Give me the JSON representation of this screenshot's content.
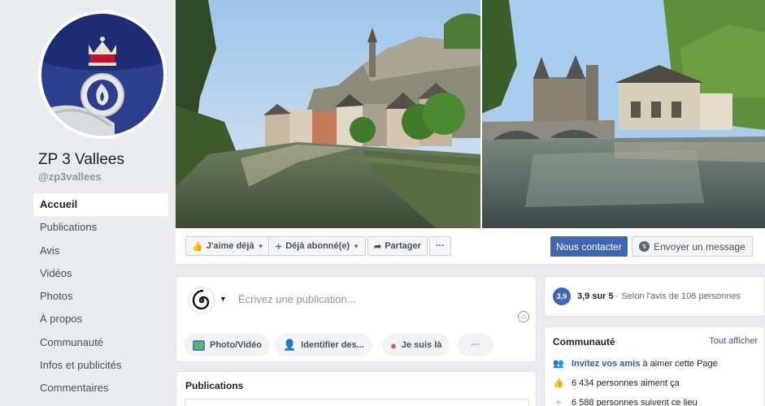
{
  "page": {
    "name": "ZP 3 Vallees",
    "handle": "@zp3vallees"
  },
  "nav": {
    "items": [
      {
        "label": "Accueil",
        "active": true
      },
      {
        "label": "Publications"
      },
      {
        "label": "Avis"
      },
      {
        "label": "Vidéos"
      },
      {
        "label": "Photos"
      },
      {
        "label": "À propos"
      },
      {
        "label": "Communauté"
      },
      {
        "label": "Infos et publicités"
      },
      {
        "label": "Commentaires"
      }
    ]
  },
  "actions": {
    "like_label": "J'aime déjà",
    "follow_label": "Déjà abonné(e)",
    "share_label": "Partager",
    "more_label": "···",
    "contact_label": "Nous contacter",
    "message_label": "Envoyer un message"
  },
  "composer": {
    "placeholder": "Écrivez une publication...",
    "photo_label": "Photo/Vidéo",
    "tag_label": "Identifier des...",
    "checkin_label": "Je suis là",
    "more_label": "···"
  },
  "publications": {
    "title": "Publications"
  },
  "rating": {
    "badge": "3,9",
    "score": "3,9 sur 5",
    "detail": " · Selon l'avis de 106 personnes"
  },
  "community": {
    "title": "Communauté",
    "see_all": "Tout afficher",
    "invite_link": "Invitez vos amis",
    "invite_rest": " à aimer cette Page",
    "likes": "6 434 personnes aiment ça",
    "follows": "6 588 personnes suivent ce lieu"
  },
  "colors": {
    "brand": "#4267b2",
    "link": "#385898",
    "background": "#e9ebee"
  }
}
